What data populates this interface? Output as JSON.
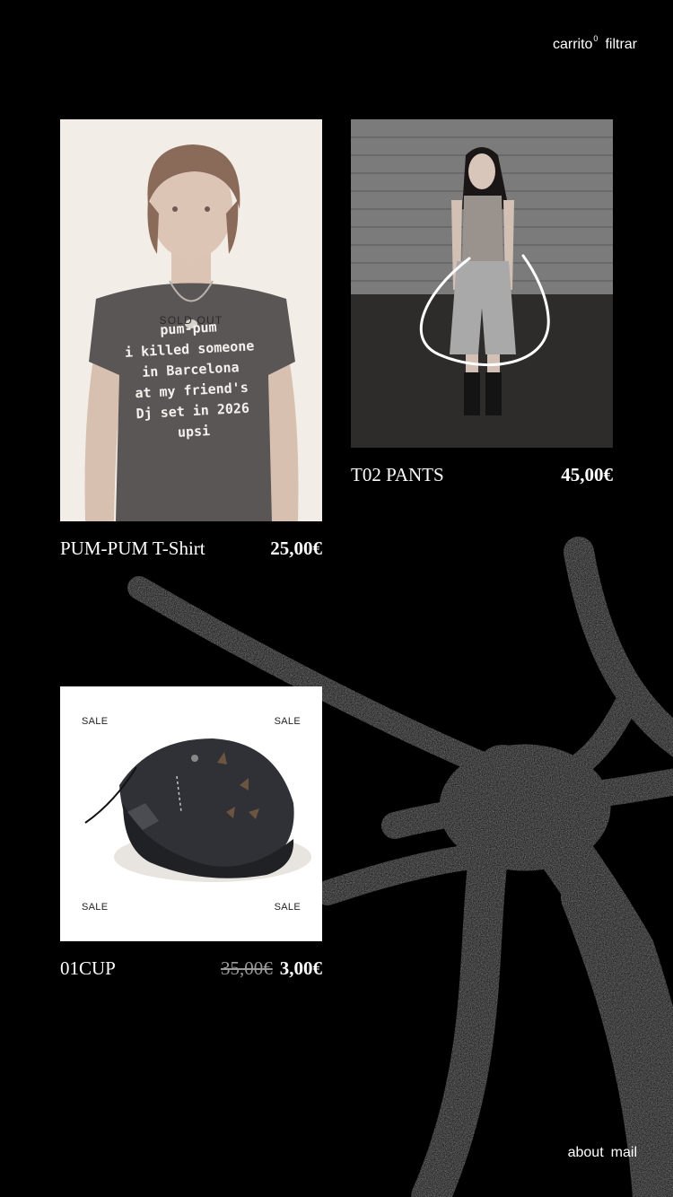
{
  "nav": {
    "cart_label": "carrito",
    "cart_count": "0",
    "filter_label": "filtrar"
  },
  "footer": {
    "about_label": "about",
    "mail_label": "mail"
  },
  "products": [
    {
      "name": "PUM-PUM T-Shirt",
      "price": "25,00€",
      "badge": "SOLD OUT",
      "shirt_print": [
        "pum-pum",
        "i killed someone",
        "in Barcelona",
        "at my friend's",
        "Dj set in 2026",
        "upsi"
      ]
    },
    {
      "name": "T02 PANTS",
      "price": "45,00€"
    },
    {
      "name": "01CUP",
      "old_price": "35,00€",
      "price": "3,00€",
      "badge": "SALE"
    }
  ]
}
